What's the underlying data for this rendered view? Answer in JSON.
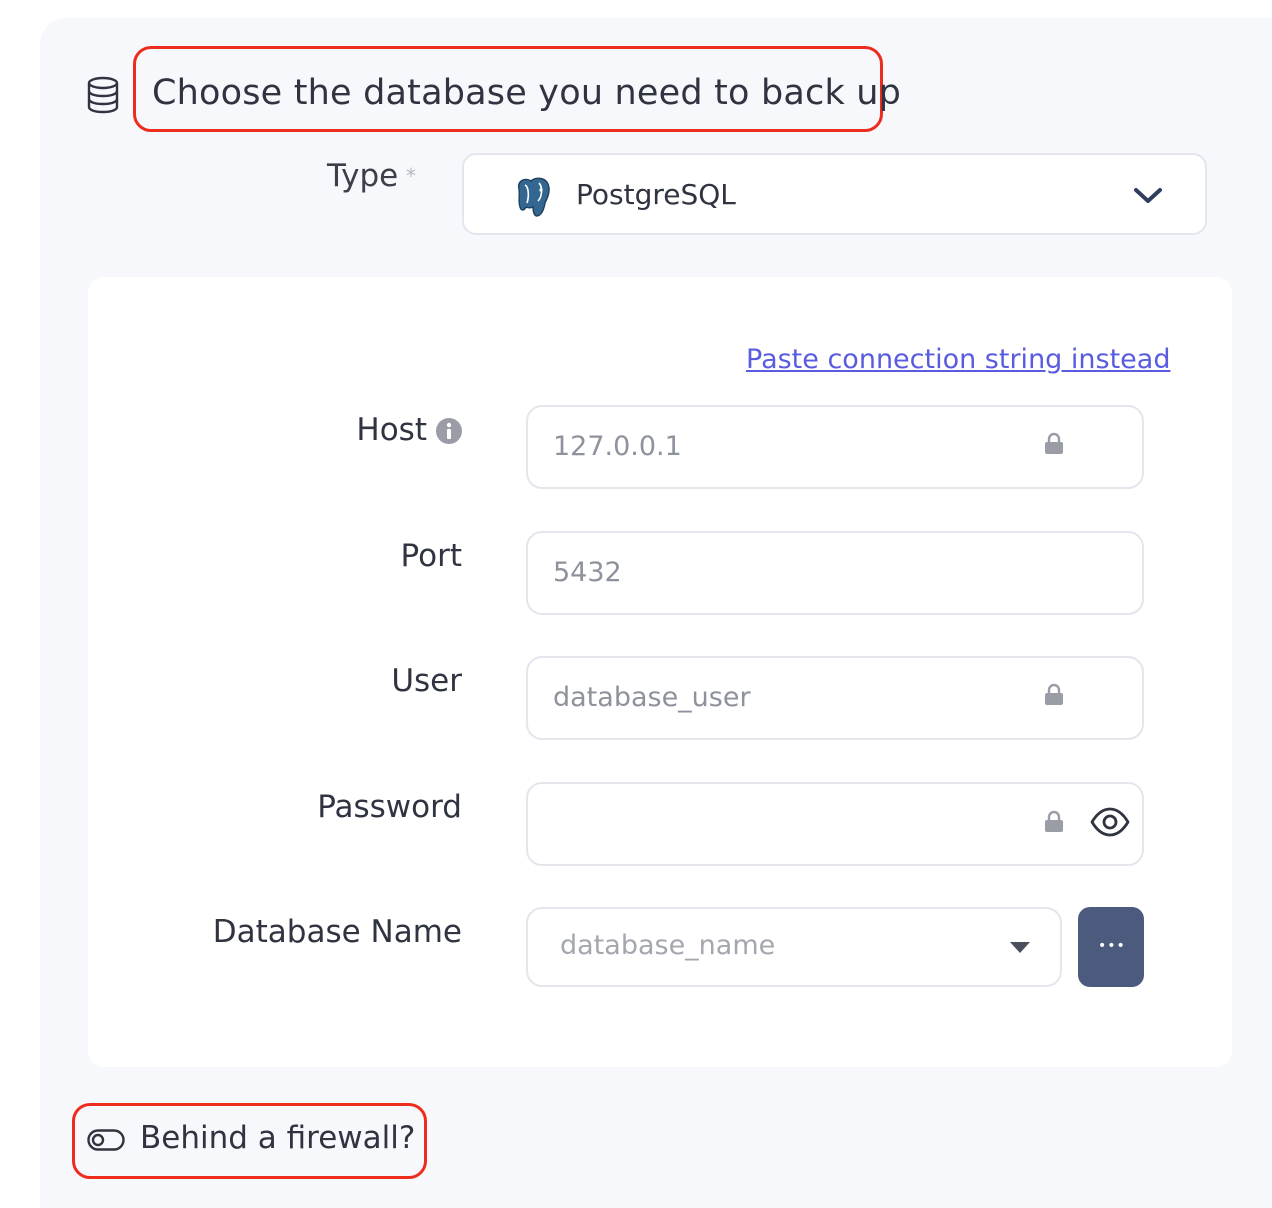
{
  "header": {
    "title": "Choose the database you need to back up",
    "icon": "database-icon"
  },
  "type_field": {
    "label": "Type",
    "required_mark": "*",
    "value": "PostgreSQL",
    "icon": "postgresql-logo-icon"
  },
  "connection_form": {
    "paste_link": "Paste connection string instead",
    "host": {
      "label": "Host",
      "placeholder": "127.0.0.1"
    },
    "port": {
      "label": "Port",
      "placeholder": "5432"
    },
    "user": {
      "label": "User",
      "placeholder": "database_user"
    },
    "password": {
      "label": "Password",
      "placeholder": ""
    },
    "database_name": {
      "label": "Database Name",
      "placeholder": "database_name",
      "more_label": "•••"
    }
  },
  "firewall": {
    "label": "Behind a firewall?",
    "enabled": false
  },
  "colors": {
    "accent_link": "#5a5ce0",
    "highlight": "#ee2c1d",
    "button": "#4c5a7d"
  }
}
